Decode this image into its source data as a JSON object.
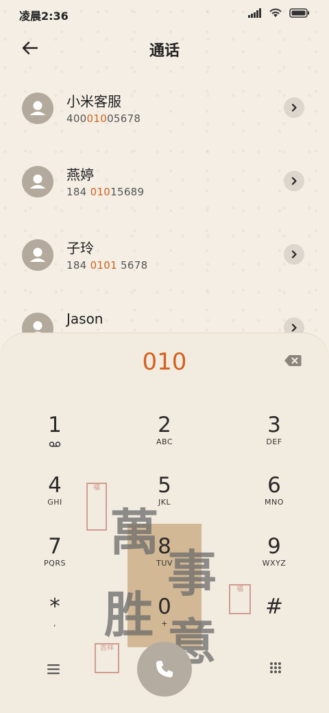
{
  "status": {
    "time": "凌晨2:36"
  },
  "header": {
    "title": "通话"
  },
  "contacts": [
    {
      "name": "小米客服",
      "num_pre": "400",
      "num_hl": "010",
      "num_post": "05678"
    },
    {
      "name": "燕婷",
      "num_pre": "184 ",
      "num_hl": "010",
      "num_post": "15689"
    },
    {
      "name": "子玲",
      "num_pre": "184 ",
      "num_hl": "0101",
      "num_post": " 5678"
    },
    {
      "name": "Jason",
      "num_pre": "",
      "num_hl": "",
      "num_post": ""
    }
  ],
  "dialer": {
    "entered": "010",
    "keys": [
      {
        "digit": "1",
        "letters": ""
      },
      {
        "digit": "2",
        "letters": "ABC"
      },
      {
        "digit": "3",
        "letters": "DEF"
      },
      {
        "digit": "4",
        "letters": "GHI"
      },
      {
        "digit": "5",
        "letters": "JKL"
      },
      {
        "digit": "6",
        "letters": "MNO"
      },
      {
        "digit": "7",
        "letters": "PQRS"
      },
      {
        "digit": "8",
        "letters": "TUV"
      },
      {
        "digit": "9",
        "letters": "WXYZ"
      },
      {
        "digit": "*",
        "letters": ","
      },
      {
        "digit": "0",
        "letters": "+"
      },
      {
        "digit": "#",
        "letters": ""
      }
    ]
  },
  "wallpaper": {
    "calligraphy": [
      "萬",
      "事",
      "胜",
      "意"
    ],
    "seals": [
      "福",
      "吉祥"
    ]
  },
  "colors": {
    "accent": "#d4601d",
    "background": "#f4eee4",
    "avatar": "#b3aa9d"
  },
  "icons": [
    "back-arrow-icon",
    "chevron-right-icon",
    "backspace-icon",
    "voicemail-icon",
    "menu-icon",
    "phone-icon",
    "dialpad-icon",
    "signal-icon",
    "wifi-icon",
    "battery-icon"
  ]
}
